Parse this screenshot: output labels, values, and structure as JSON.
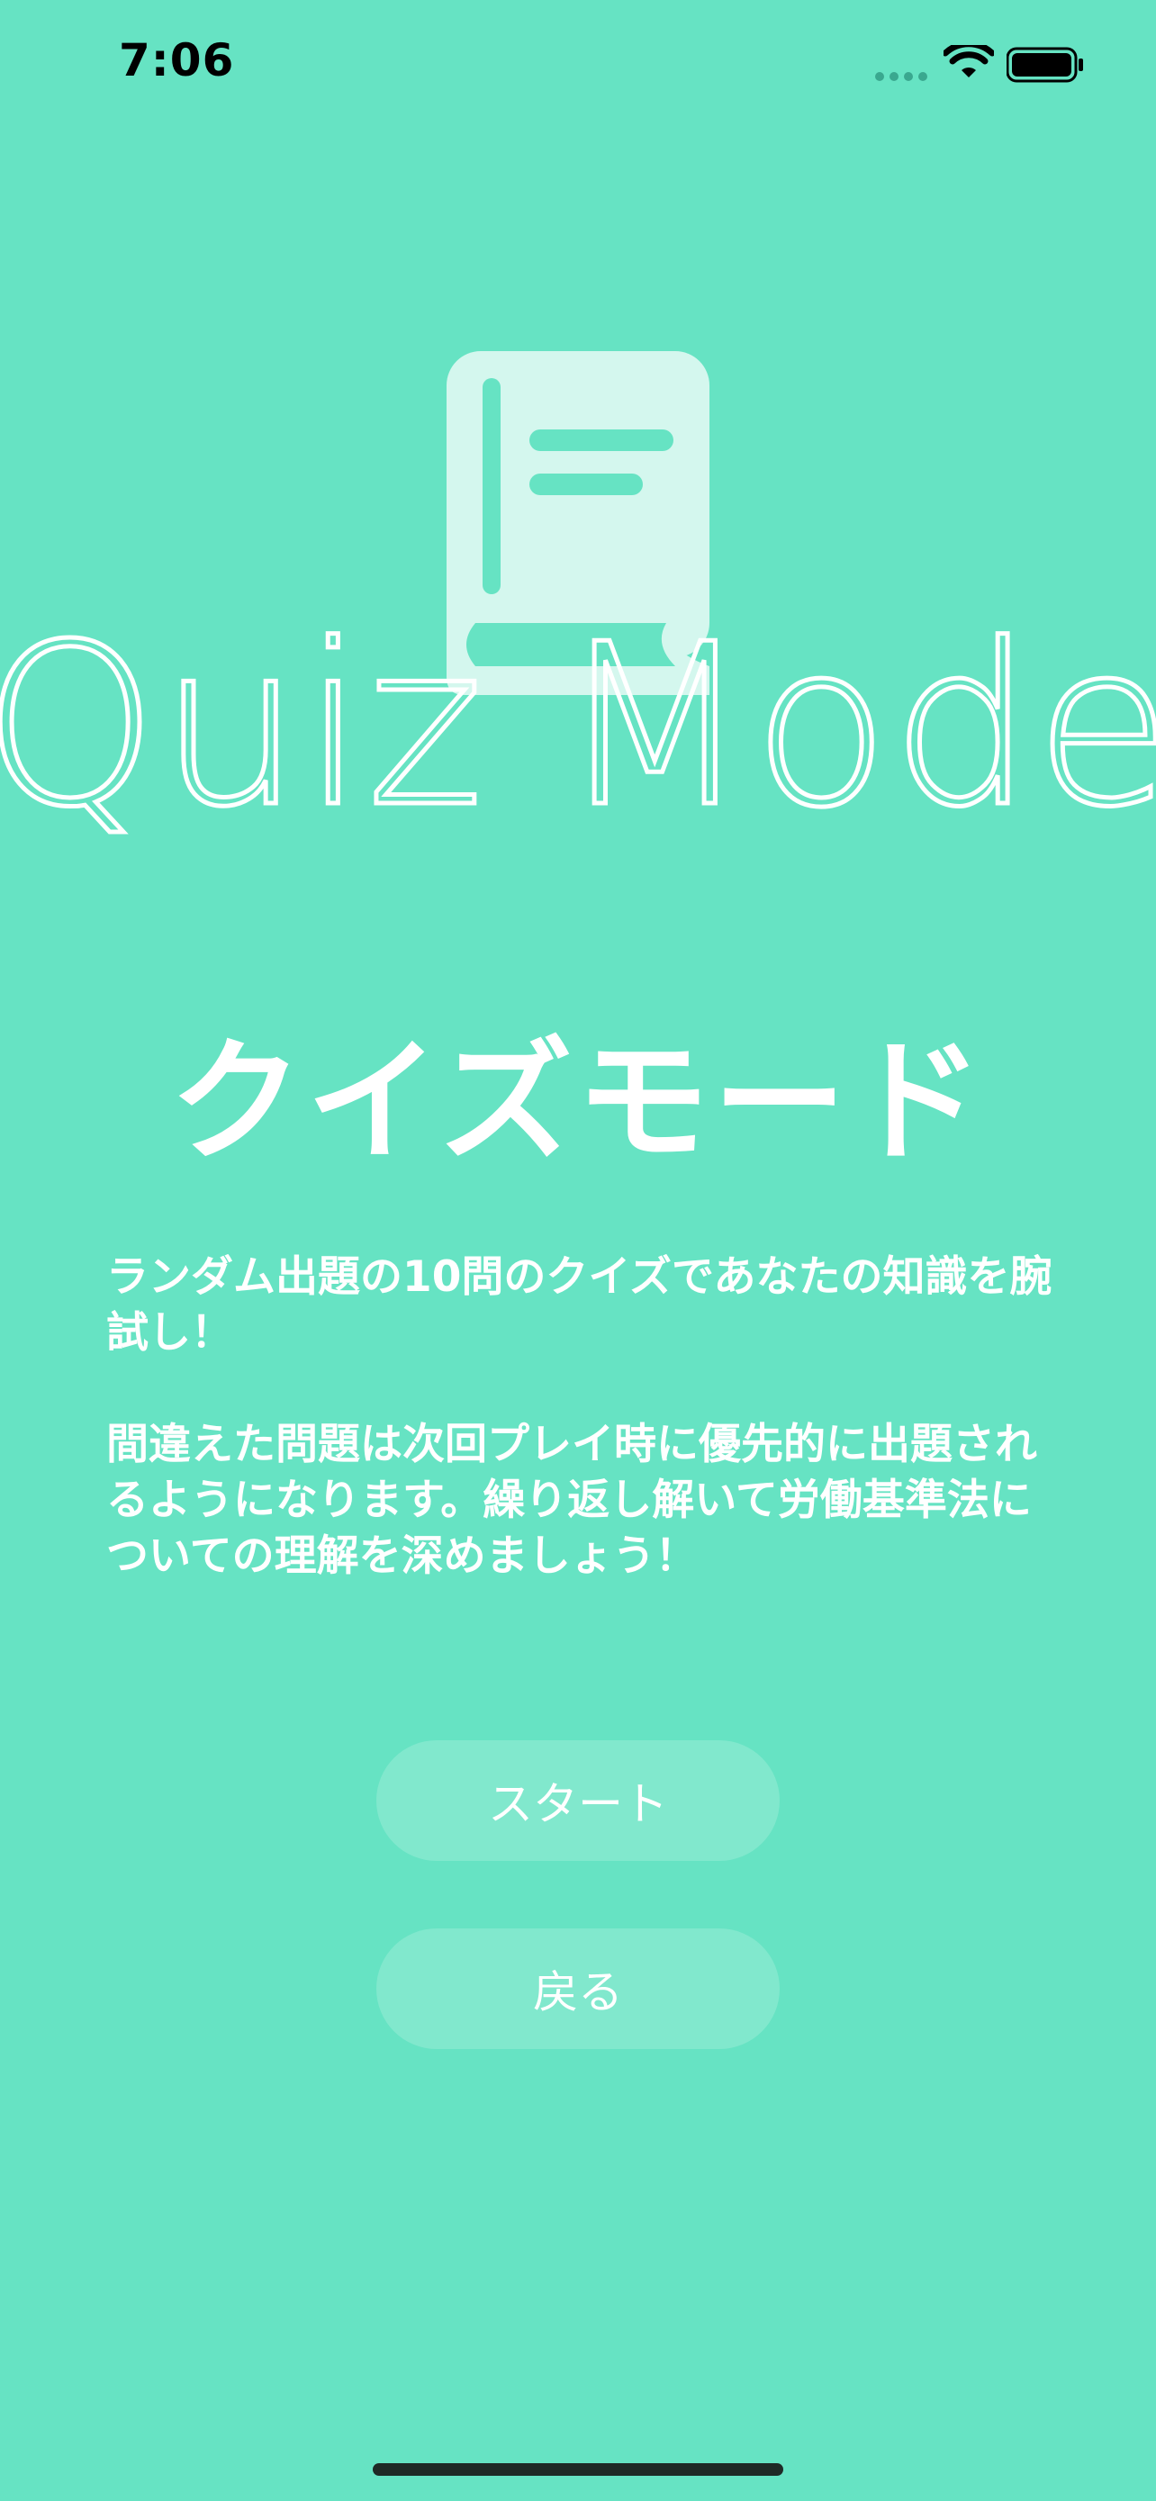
{
  "status_bar": {
    "time": "7:06"
  },
  "hero": {
    "title": "Quiz Mode",
    "icon": "book-icon"
  },
  "main": {
    "title": "クイズモード",
    "description": [
      "ランダム出題の10問のクイズであなたの知識を腕試し！",
      "間違えた問題は次回プレイ時に優先的に出題されるようになります。繰り返し解いて労働基準法についての理解を深めましょう！"
    ]
  },
  "buttons": {
    "start": "スタート",
    "back": "戻る"
  },
  "colors": {
    "background": "#66e3c3",
    "button_fill": "rgba(255,255,255,0.18)"
  }
}
